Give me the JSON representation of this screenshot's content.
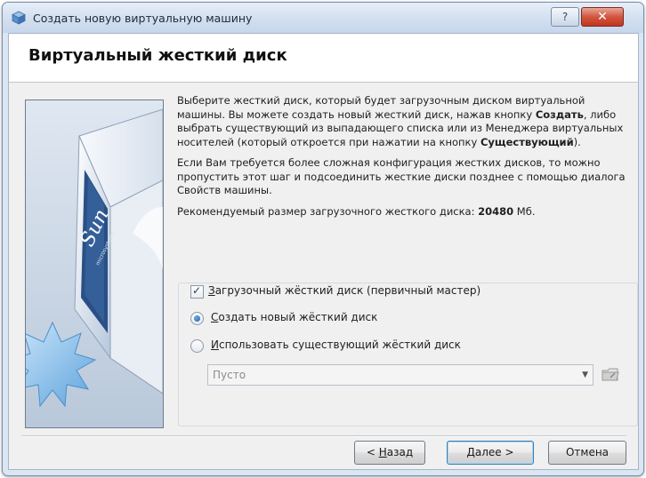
{
  "window": {
    "title": "Создать новую виртуальную машину",
    "help_glyph": "?",
    "close_glyph": "✕"
  },
  "page": {
    "heading": "Виртуальный жесткий диск"
  },
  "side_image": {
    "logo_text": "Sun",
    "logo_sub": "microsystems"
  },
  "description": {
    "p1_a": "Выберите жесткий диск, который будет загрузочным диском виртуальной машины. Вы можете создать новый жесткий диск, нажав кнопку ",
    "p1_bold1": "Создать",
    "p1_b": ", либо выбрать существующий из выпадающего списка или из Менеджера виртуальных носителей (который откроется при нажатии на кнопку ",
    "p1_bold2": "Существующий",
    "p1_c": ").",
    "p2": "Если Вам требуется более сложная конфигурация жестких дисков, то можно пропустить этот шаг и подсоединить жесткие диски позднее с помощью диалога Свойств машины.",
    "p3_a": "Рекомендуемый размер загрузочного жесткого диска: ",
    "p3_value": "20480",
    "p3_unit": " Мб."
  },
  "options": {
    "boot_disk_checkbox": {
      "label_u": "З",
      "label_rest": "агрузочный жёсткий диск (первичный мастер)",
      "checked": true
    },
    "create_new_radio": {
      "label_u": "С",
      "label_rest": "оздать новый жёсткий диск",
      "selected": true
    },
    "use_existing_radio": {
      "label_u": "И",
      "label_rest": "спользовать существующий жёсткий диск",
      "selected": false
    },
    "existing_disk_select": {
      "value": "Пусто"
    }
  },
  "buttons": {
    "back_prefix": "< ",
    "back_u": "Н",
    "back_rest": "азад",
    "next_u": "Д",
    "next_rest": "алее >",
    "cancel": "Отмена"
  },
  "colors": {
    "accent": "#3c7fb1",
    "title_bar": "#d2dff0",
    "close_button": "#c2351e"
  }
}
